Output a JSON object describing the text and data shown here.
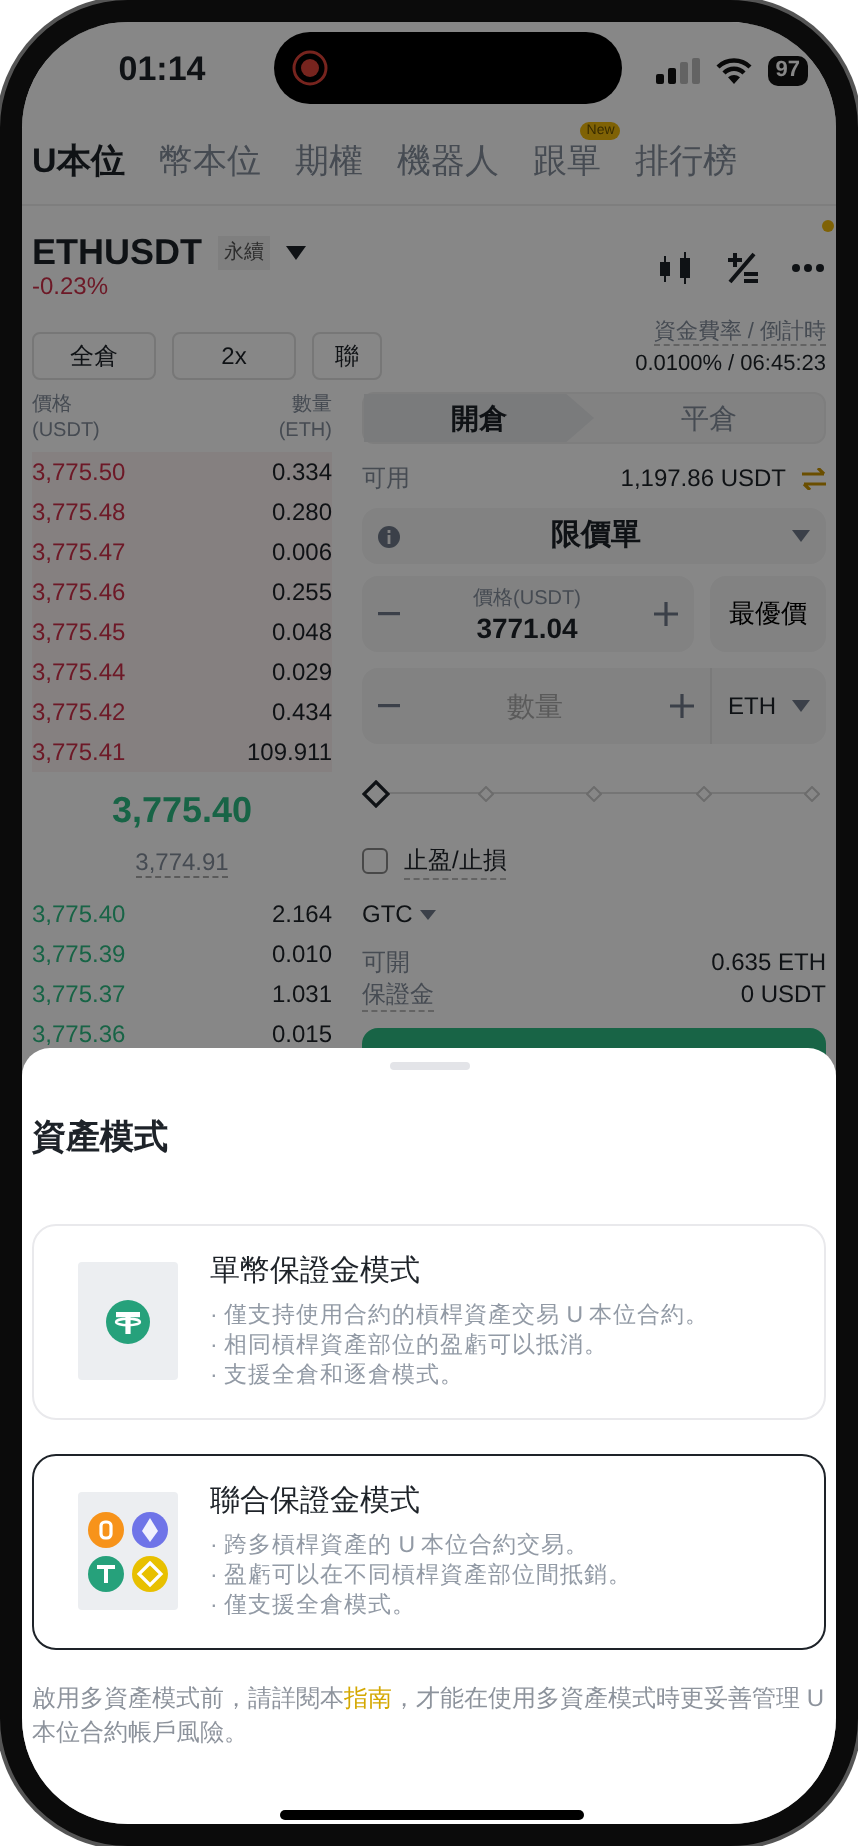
{
  "status_bar": {
    "time": "01:14",
    "battery": "97"
  },
  "tabs": [
    {
      "label": "U本位",
      "selected": true
    },
    {
      "label": "幣本位",
      "selected": false
    },
    {
      "label": "期權",
      "selected": false
    },
    {
      "label": "機器人",
      "selected": false
    },
    {
      "label": "跟單",
      "selected": false,
      "badge": "New"
    },
    {
      "label": "排行榜",
      "selected": false
    }
  ],
  "symbol": {
    "name": "ETHUSDT",
    "contract": "永續",
    "change": "-0.23%",
    "menu_alert": true
  },
  "margin_buttons": [
    "全倉",
    "2x",
    "聯"
  ],
  "funding": {
    "label": "資金費率 / 倒計時",
    "value": "0.0100% / 06:45:23"
  },
  "order_book": {
    "price_header": "價格",
    "price_unit": "(USDT)",
    "qty_header": "數量",
    "qty_unit": "(ETH)",
    "asks": [
      {
        "price": "3,775.50",
        "qty": "0.334"
      },
      {
        "price": "3,775.48",
        "qty": "0.280"
      },
      {
        "price": "3,775.47",
        "qty": "0.006"
      },
      {
        "price": "3,775.46",
        "qty": "0.255"
      },
      {
        "price": "3,775.45",
        "qty": "0.048"
      },
      {
        "price": "3,775.44",
        "qty": "0.029"
      },
      {
        "price": "3,775.42",
        "qty": "0.434"
      },
      {
        "price": "3,775.41",
        "qty": "109.911"
      }
    ],
    "last_price": "3,775.40",
    "mark_price": "3,774.91",
    "bids": [
      {
        "price": "3,775.40",
        "qty": "2.164"
      },
      {
        "price": "3,775.39",
        "qty": "0.010"
      },
      {
        "price": "3,775.37",
        "qty": "1.031"
      },
      {
        "price": "3,775.36",
        "qty": "0.015"
      }
    ]
  },
  "order_form": {
    "side_tabs": [
      {
        "label": "開倉",
        "selected": true
      },
      {
        "label": "平倉",
        "selected": false
      }
    ],
    "available_label": "可用",
    "available": "1,197.86 USDT",
    "order_type": "限價單",
    "price_label": "價格(USDT)",
    "price": "3771.04",
    "best_price": "最優價",
    "quantity_placeholder": "數量",
    "quantity_unit": "ETH",
    "slider": {
      "level": 0
    },
    "tp_sl": {
      "label": "止盈/止損",
      "checked": false
    },
    "time_in_force": "GTC",
    "max_open_label": "可開",
    "max_open": "0.635 ETH",
    "margin_label": "保證金",
    "margin": "0 USDT"
  },
  "sheet": {
    "title": "資產模式",
    "modes": [
      {
        "kind": "single",
        "title": "單幣保證金模式",
        "selected": false,
        "points": [
          "· 僅支持使用合約的槓桿資產交易 U 本位合約。",
          "· 相同槓桿資產部位的盈虧可以抵消。",
          "· 支援全倉和逐倉模式。"
        ]
      },
      {
        "kind": "multi",
        "title": "聯合保證金模式",
        "selected": true,
        "points": [
          "· 跨多槓桿資產的 U 本位合約交易。",
          "· 盈虧可以在不同槓桿資產部位間抵銷。",
          "· 僅支援全倉模式。"
        ]
      }
    ],
    "note_before": "啟用多資產模式前，請詳閱本",
    "note_link": "指南",
    "note_after": "，才能在使用多資產模式時更妥善管理 U 本位合約帳戶風險。"
  }
}
